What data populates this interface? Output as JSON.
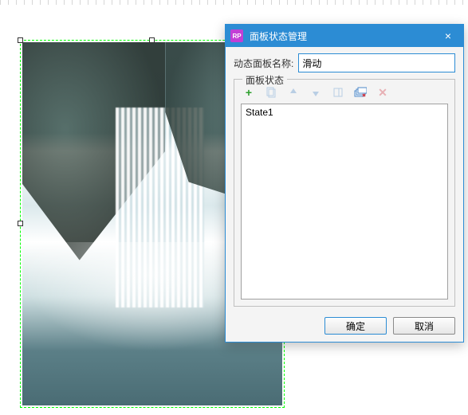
{
  "dialog": {
    "title": "面板状态管理",
    "name_label": "动态面板名称:",
    "name_value": "滑动",
    "fieldset_legend": "面板状态",
    "toolbar": {
      "add": {
        "name": "add-state-button",
        "enabled": true
      },
      "duplicate": {
        "name": "duplicate-state-button",
        "enabled": false
      },
      "moveup": {
        "name": "move-up-button",
        "enabled": false
      },
      "movedown": {
        "name": "move-down-button",
        "enabled": false
      },
      "edit": {
        "name": "edit-state-button",
        "enabled": false
      },
      "editall": {
        "name": "edit-all-button",
        "enabled": true
      },
      "delete": {
        "name": "delete-state-button",
        "enabled": false
      }
    },
    "states": [
      "State1"
    ],
    "ok_label": "确定",
    "cancel_label": "取消"
  }
}
